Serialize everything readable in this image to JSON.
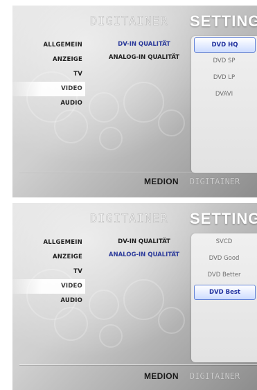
{
  "screens": [
    {
      "brand": "DIGITAINER",
      "title": "SETTINGS",
      "nav": [
        "ALLGEMEIN",
        "ANZEIGE",
        "TV",
        "VIDEO",
        "AUDIO"
      ],
      "nav_active": "VIDEO",
      "submenu": [
        "DV-IN QUALITÄT",
        "ANALOG-IN QUALITÄT"
      ],
      "submenu_selected": "DV-IN QUALITÄT",
      "options": [
        "DVD HQ",
        "DVD SP",
        "DVD LP",
        "DVAVI"
      ],
      "option_selected": "DVD HQ",
      "footer_logo": "MEDION",
      "footer_brand": "DIGITAINER"
    },
    {
      "brand": "DIGITAINER",
      "title": "SETTINGS",
      "nav": [
        "ALLGEMEIN",
        "ANZEIGE",
        "TV",
        "VIDEO",
        "AUDIO"
      ],
      "nav_active": "VIDEO",
      "submenu": [
        "DV-IN QUALITÄT",
        "ANALOG-IN QUALITÄT"
      ],
      "submenu_selected": "ANALOG-IN QUALITÄT",
      "options": [
        "SVCD",
        "DVD Good",
        "DVD Better",
        "DVD Best"
      ],
      "option_selected": "DVD Best",
      "footer_logo": "MEDION",
      "footer_brand": "DIGITAINER"
    }
  ]
}
